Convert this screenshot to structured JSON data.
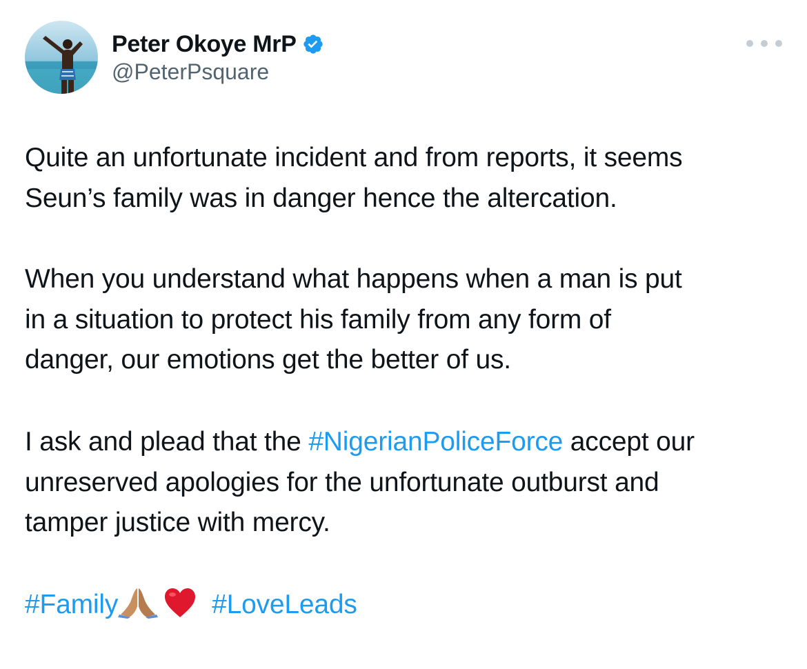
{
  "author": {
    "display_name": "Peter Okoye MrP",
    "handle": "@PeterPsquare",
    "verified": true,
    "avatar_icon": "profile-photo-man-at-beach"
  },
  "colors": {
    "link": "#1d9bf0",
    "text": "#0f1419",
    "secondary": "#536471",
    "verified_badge": "#1d9bf0"
  },
  "tweet": {
    "para1": "Quite an unfortunate incident and from reports, it seems\nSeun’s family was in danger hence the altercation.",
    "para2": "When you understand what happens when a man is put\nin a situation to protect his family from any form of\ndanger, our emotions get the better of us.",
    "para3_before": "I ask and plead that the ",
    "para3_hashtag": "#NigerianPoliceForce",
    "para3_after": " accept our\nunreserved apologies for the unfortunate outburst and\ntamper justice with mercy.",
    "hashtag_family": "#Family",
    "hashtag_loveleads": "#LoveLeads",
    "emojis": [
      "praying-hands-emoji",
      "red-heart-emoji"
    ]
  }
}
